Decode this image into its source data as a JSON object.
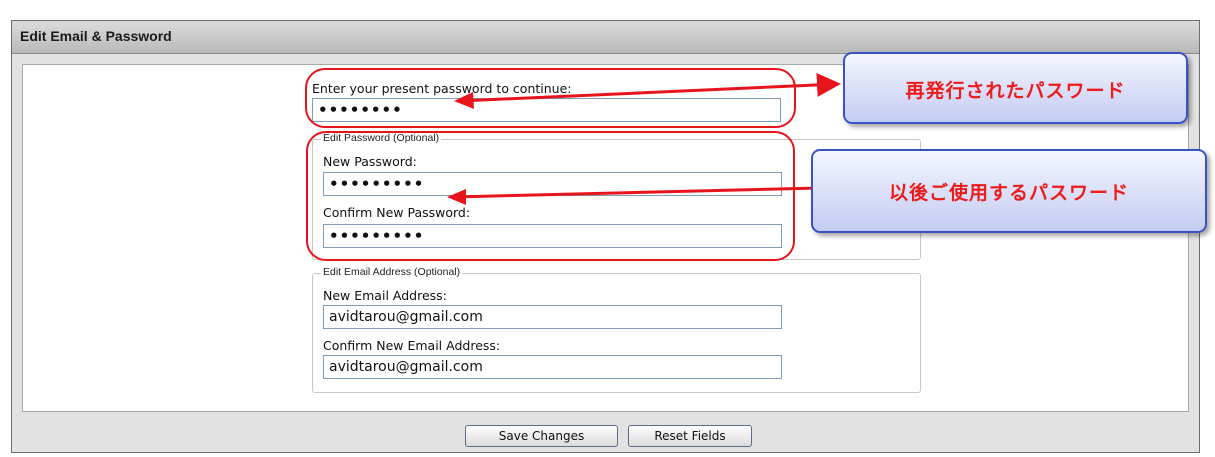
{
  "panel": {
    "title": "Edit Email & Password"
  },
  "present_password": {
    "label": "Enter your present password to continue:",
    "value": "••••••••"
  },
  "edit_password": {
    "legend": "Edit Password (Optional)",
    "new_label": "New Password:",
    "new_value": "•••••••••",
    "confirm_label": "Confirm New Password:",
    "confirm_value": "•••••••••"
  },
  "edit_email": {
    "legend": "Edit Email Address (Optional)",
    "new_label": "New Email Address:",
    "new_value": "avidtarou@gmail.com",
    "confirm_label": "Confirm New Email Address:",
    "confirm_value": "avidtarou@gmail.com"
  },
  "buttons": {
    "save": "Save Changes",
    "reset": "Reset Fields"
  },
  "annotations": {
    "callout_reissued": "再発行されたパスワード",
    "callout_future": "以後ご使用するパスワード",
    "color": "#e8141c"
  }
}
